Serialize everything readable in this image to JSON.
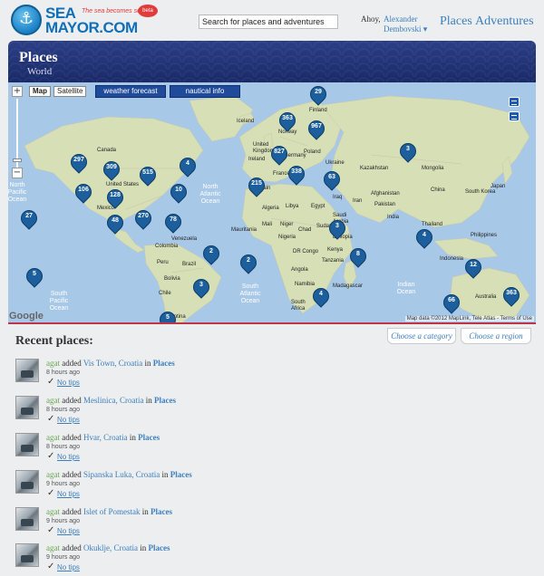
{
  "header": {
    "logo_sea": "SEA",
    "logo_mayor": "MAYOR.COM",
    "logo_tagline": "The sea becomes social!",
    "logo_badge": "beta",
    "search_placeholder": "Search for places and adventures",
    "greeting": "Ahoy,",
    "user_name": "Alexander Dembovski ▾",
    "nav": {
      "places": "Places",
      "adventures": "Adventures"
    }
  },
  "banner": {
    "title": "Places",
    "subtitle": "World"
  },
  "map": {
    "map_type": [
      "Map",
      "Satellite"
    ],
    "tabs": [
      "weather forecast",
      "nautical info"
    ],
    "attribution_logo": "Google",
    "attribution": "Map data ©2012 MapLink, Tele Atlas - Terms of Use",
    "zoom_in": "+",
    "zoom_out": "−",
    "markers": [
      "29",
      "363",
      "967",
      "827",
      "3",
      "297",
      "309",
      "515",
      "4",
      "338",
      "215",
      "63",
      "106",
      "128",
      "10",
      "27",
      "48",
      "270",
      "78",
      "3",
      "4",
      "2",
      "2",
      "8",
      "5",
      "3",
      "12",
      "5",
      "4",
      "66",
      "363"
    ],
    "labels": [
      "Iceland",
      "Finland",
      "Norway",
      "United Kingdom",
      "Ireland",
      "Germany",
      "Poland",
      "Ukraine",
      "France",
      "Spain",
      "Kazakhstan",
      "Mongolia",
      "China",
      "South Korea",
      "Japan",
      "Iraq",
      "Iran",
      "Afghanistan",
      "Pakistan",
      "India",
      "Thailand",
      "Philippines",
      "Indonesia",
      "Saudi Arabia",
      "Egypt",
      "Libya",
      "Algeria",
      "Mali",
      "Niger",
      "Chad",
      "Sudan",
      "Nigeria",
      "Ethiopia",
      "Kenya",
      "DR Congo",
      "Tanzania",
      "Angola",
      "Namibia",
      "South Africa",
      "Madagascar",
      "Mauritania",
      "Canada",
      "United States",
      "Mexico",
      "Venezuela",
      "Colombia",
      "Peru",
      "Brazil",
      "Bolivia",
      "Chile",
      "Argentina",
      "Australia"
    ],
    "oceans": [
      "North Atlantic Ocean",
      "South Atlantic Ocean",
      "Indian Ocean",
      "South Pacific Ocean",
      "North Pacific Ocean"
    ]
  },
  "panel": {
    "recent_title": "Recent places:",
    "choose_category": "Choose a category",
    "choose_region": "Choose a region"
  },
  "entries": [
    {
      "user": "agat",
      "verb": "added",
      "place": "Vis Town, Croatia",
      "in": "in",
      "category": "Places",
      "time": "8 hours ago",
      "tips": "No tips"
    },
    {
      "user": "agat",
      "verb": "added",
      "place": "Meslinica, Croatia",
      "in": "in",
      "category": "Places",
      "time": "8 hours ago",
      "tips": "No tips"
    },
    {
      "user": "agat",
      "verb": "added",
      "place": "Hvar, Croatia",
      "in": "in",
      "category": "Places",
      "time": "8 hours ago",
      "tips": "No tips"
    },
    {
      "user": "agat",
      "verb": "added",
      "place": "Sipanska Luka, Croatia",
      "in": "in",
      "category": "Places",
      "time": "9 hours ago",
      "tips": "No tips"
    },
    {
      "user": "agat",
      "verb": "added",
      "place": "Islet of Pomestak",
      "in": "in",
      "category": "Places",
      "time": "9 hours ago",
      "tips": "No tips"
    },
    {
      "user": "agat",
      "verb": "added",
      "place": "Okuklje, Croatia",
      "in": "in",
      "category": "Places",
      "time": "9 hours ago",
      "tips": "No tips"
    }
  ],
  "colors": {
    "brand": "#0f6fb8",
    "link": "#3d7fbd",
    "banner": "#1f3070",
    "marker": "#1c5f9c",
    "user": "#6aa84f"
  }
}
